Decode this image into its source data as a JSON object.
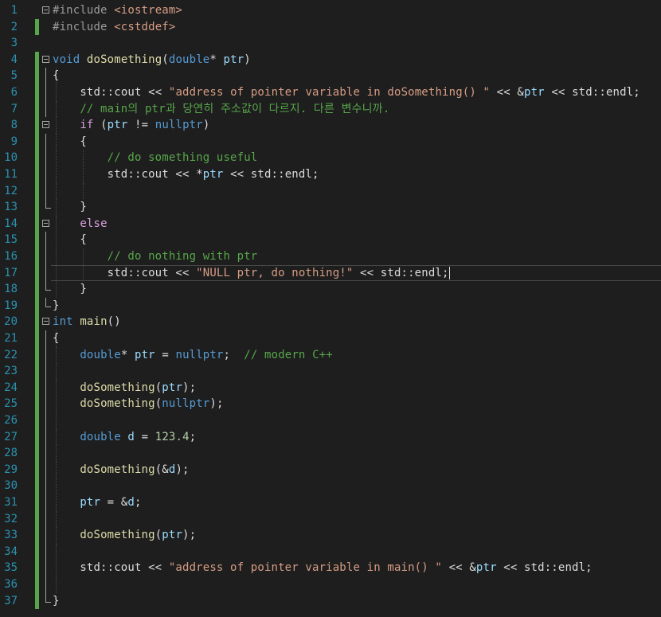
{
  "editor": {
    "line_numbers": [
      "1",
      "2",
      "3",
      "4",
      "5",
      "6",
      "7",
      "8",
      "9",
      "10",
      "11",
      "12",
      "13",
      "14",
      "15",
      "16",
      "17",
      "18",
      "19",
      "20",
      "21",
      "22",
      "23",
      "24",
      "25",
      "26",
      "27",
      "28",
      "29",
      "30",
      "31",
      "32",
      "33",
      "34",
      "35",
      "36",
      "37"
    ],
    "lines": [
      [
        {
          "t": "#include ",
          "c": "pp"
        },
        {
          "t": "<iostream>",
          "c": "inc"
        }
      ],
      [
        {
          "t": "#include ",
          "c": "pp"
        },
        {
          "t": "<cstddef>",
          "c": "inc"
        }
      ],
      [],
      [
        {
          "t": "void",
          "c": "kw"
        },
        {
          "t": " ",
          "c": "pl"
        },
        {
          "t": "doSomething",
          "c": "fn"
        },
        {
          "t": "(",
          "c": "pl"
        },
        {
          "t": "double",
          "c": "kw"
        },
        {
          "t": "* ",
          "c": "pl"
        },
        {
          "t": "ptr",
          "c": "id"
        },
        {
          "t": ")",
          "c": "pl"
        }
      ],
      [
        {
          "t": "{",
          "c": "pl"
        }
      ],
      [
        {
          "t": "    std",
          "c": "pl"
        },
        {
          "t": "::",
          "c": "pl"
        },
        {
          "t": "cout",
          "c": "pl"
        },
        {
          "t": " << ",
          "c": "pl"
        },
        {
          "t": "\"address of pointer variable in doSomething() \"",
          "c": "str"
        },
        {
          "t": " << &",
          "c": "pl"
        },
        {
          "t": "ptr",
          "c": "id"
        },
        {
          "t": " << std::",
          "c": "pl"
        },
        {
          "t": "endl",
          "c": "pl"
        },
        {
          "t": ";",
          "c": "pl"
        }
      ],
      [
        {
          "t": "    // main의 ptr과 당연히 주소값이 다르지. 다른 변수니까.",
          "c": "cm"
        }
      ],
      [
        {
          "t": "    ",
          "c": "pl"
        },
        {
          "t": "if",
          "c": "ctl"
        },
        {
          "t": " (",
          "c": "pl"
        },
        {
          "t": "ptr",
          "c": "id"
        },
        {
          "t": " != ",
          "c": "pl"
        },
        {
          "t": "nullptr",
          "c": "kw"
        },
        {
          "t": ")",
          "c": "pl"
        }
      ],
      [
        {
          "t": "    {",
          "c": "pl"
        }
      ],
      [
        {
          "t": "        // do something useful",
          "c": "cm"
        }
      ],
      [
        {
          "t": "        std::cout << *",
          "c": "pl"
        },
        {
          "t": "ptr",
          "c": "id"
        },
        {
          "t": " << std::endl;",
          "c": "pl"
        }
      ],
      [],
      [
        {
          "t": "    }",
          "c": "pl"
        }
      ],
      [
        {
          "t": "    ",
          "c": "pl"
        },
        {
          "t": "else",
          "c": "ctl"
        }
      ],
      [
        {
          "t": "    {",
          "c": "pl"
        }
      ],
      [
        {
          "t": "        // do nothing with ptr",
          "c": "cm"
        }
      ],
      [
        {
          "t": "        std::cout << ",
          "c": "pl"
        },
        {
          "t": "\"NULL ptr, do nothing!\"",
          "c": "str"
        },
        {
          "t": " << std::endl;",
          "c": "pl"
        }
      ],
      [
        {
          "t": "    }",
          "c": "pl"
        }
      ],
      [
        {
          "t": "}",
          "c": "pl"
        }
      ],
      [
        {
          "t": "int",
          "c": "kw"
        },
        {
          "t": " ",
          "c": "pl"
        },
        {
          "t": "main",
          "c": "fn"
        },
        {
          "t": "()",
          "c": "pl"
        }
      ],
      [
        {
          "t": "{",
          "c": "pl"
        }
      ],
      [
        {
          "t": "    ",
          "c": "pl"
        },
        {
          "t": "double",
          "c": "kw"
        },
        {
          "t": "* ",
          "c": "pl"
        },
        {
          "t": "ptr",
          "c": "id"
        },
        {
          "t": " = ",
          "c": "pl"
        },
        {
          "t": "nullptr",
          "c": "kw"
        },
        {
          "t": ";  ",
          "c": "pl"
        },
        {
          "t": "// modern C++",
          "c": "cm"
        }
      ],
      [],
      [
        {
          "t": "    ",
          "c": "pl"
        },
        {
          "t": "doSomething",
          "c": "fn"
        },
        {
          "t": "(",
          "c": "pl"
        },
        {
          "t": "ptr",
          "c": "id"
        },
        {
          "t": ");",
          "c": "pl"
        }
      ],
      [
        {
          "t": "    ",
          "c": "pl"
        },
        {
          "t": "doSomething",
          "c": "fn"
        },
        {
          "t": "(",
          "c": "pl"
        },
        {
          "t": "nullptr",
          "c": "kw"
        },
        {
          "t": ");",
          "c": "pl"
        }
      ],
      [],
      [
        {
          "t": "    ",
          "c": "pl"
        },
        {
          "t": "double",
          "c": "kw"
        },
        {
          "t": " ",
          "c": "pl"
        },
        {
          "t": "d",
          "c": "id"
        },
        {
          "t": " = ",
          "c": "pl"
        },
        {
          "t": "123.4",
          "c": "num"
        },
        {
          "t": ";",
          "c": "pl"
        }
      ],
      [],
      [
        {
          "t": "    ",
          "c": "pl"
        },
        {
          "t": "doSomething",
          "c": "fn"
        },
        {
          "t": "(&",
          "c": "pl"
        },
        {
          "t": "d",
          "c": "id"
        },
        {
          "t": ");",
          "c": "pl"
        }
      ],
      [],
      [
        {
          "t": "    ",
          "c": "pl"
        },
        {
          "t": "ptr",
          "c": "id"
        },
        {
          "t": " = &",
          "c": "pl"
        },
        {
          "t": "d",
          "c": "id"
        },
        {
          "t": ";",
          "c": "pl"
        }
      ],
      [],
      [
        {
          "t": "    ",
          "c": "pl"
        },
        {
          "t": "doSomething",
          "c": "fn"
        },
        {
          "t": "(",
          "c": "pl"
        },
        {
          "t": "ptr",
          "c": "id"
        },
        {
          "t": ");",
          "c": "pl"
        }
      ],
      [],
      [
        {
          "t": "    std::cout << ",
          "c": "pl"
        },
        {
          "t": "\"address of pointer variable in main() \"",
          "c": "str"
        },
        {
          "t": " << &",
          "c": "pl"
        },
        {
          "t": "ptr",
          "c": "id"
        },
        {
          "t": " << std::endl;",
          "c": "pl"
        }
      ],
      [],
      [
        {
          "t": "}",
          "c": "pl"
        }
      ]
    ],
    "current_line": 17,
    "colors": {
      "background": "#1e1e1e",
      "line_number": "#2b91af",
      "change_bar": "#57a64a",
      "keyword": "#569cd6",
      "string": "#d69d85",
      "comment": "#57a64a",
      "function": "#dcdcaa",
      "identifier": "#9cdcfe"
    }
  }
}
